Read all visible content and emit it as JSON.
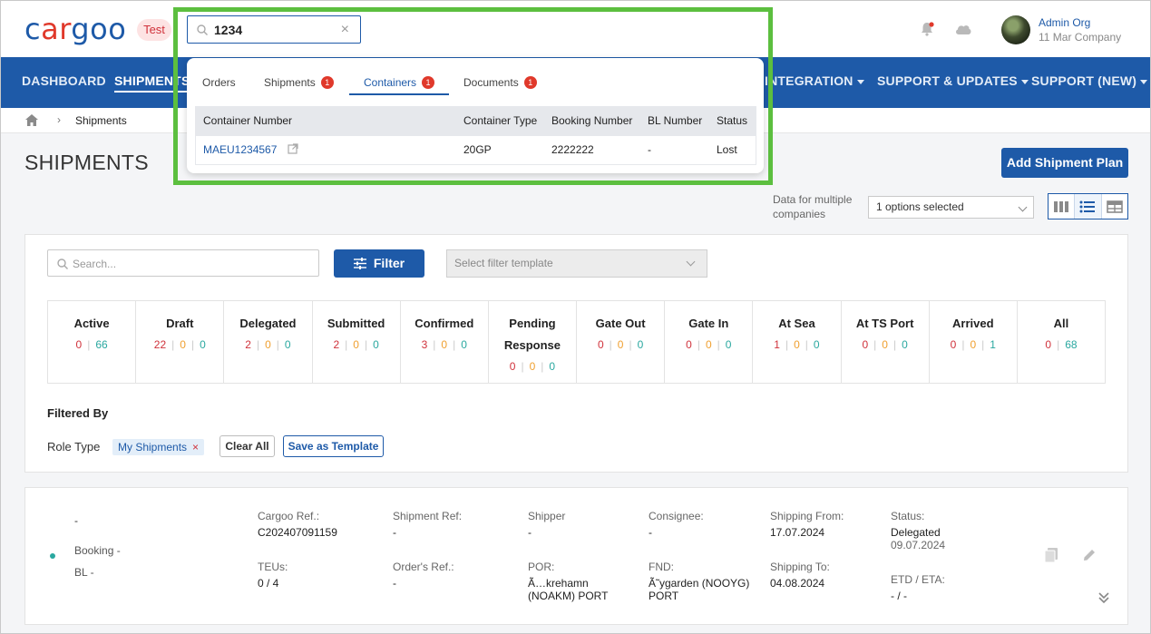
{
  "header": {
    "logo": {
      "part1": "c",
      "part2": "ar",
      "part3": "goo"
    },
    "env_badge": "Test",
    "user_name": "Admin Org",
    "user_company": "11 Mar Company"
  },
  "nav": {
    "items": [
      {
        "label": "DASHBOARD",
        "active": false,
        "caret": false
      },
      {
        "label": "SHIPMENTS",
        "active": true,
        "caret": false
      },
      {
        "label": "INTEGRATION",
        "active": false,
        "caret": true
      },
      {
        "label": "SUPPORT & UPDATES",
        "active": false,
        "caret": true
      },
      {
        "label": "SUPPORT (NEW)",
        "active": false,
        "caret": true
      }
    ]
  },
  "breadcrumb": {
    "current": "Shipments"
  },
  "page": {
    "title": "SHIPMENTS",
    "add_plan_label": "Add Shipment Plan",
    "multi_company_label": "Data for multiple companies",
    "multi_company_value": "1 options selected"
  },
  "filters": {
    "search_placeholder": "Search...",
    "filter_label": "Filter",
    "template_placeholder": "Select filter template",
    "statuses": [
      {
        "name": "Active",
        "n": [
          "0",
          "66"
        ],
        "colors": [
          "red",
          "teal"
        ]
      },
      {
        "name": "Draft",
        "n": [
          "22",
          "0",
          "0"
        ],
        "colors": [
          "red",
          "orange",
          "teal"
        ]
      },
      {
        "name": "Delegated",
        "n": [
          "2",
          "0",
          "0"
        ],
        "colors": [
          "red",
          "orange",
          "teal"
        ]
      },
      {
        "name": "Submitted",
        "n": [
          "2",
          "0",
          "0"
        ],
        "colors": [
          "red",
          "orange",
          "teal"
        ]
      },
      {
        "name": "Confirmed",
        "n": [
          "3",
          "0",
          "0"
        ],
        "colors": [
          "red",
          "orange",
          "teal"
        ]
      },
      {
        "name": "Pending Response",
        "n": [
          "0",
          "0",
          "0"
        ],
        "colors": [
          "red",
          "orange",
          "teal"
        ]
      },
      {
        "name": "Gate Out",
        "n": [
          "0",
          "0",
          "0"
        ],
        "colors": [
          "red",
          "orange",
          "teal"
        ]
      },
      {
        "name": "Gate In",
        "n": [
          "0",
          "0",
          "0"
        ],
        "colors": [
          "red",
          "orange",
          "teal"
        ]
      },
      {
        "name": "At Sea",
        "n": [
          "1",
          "0",
          "0"
        ],
        "colors": [
          "red",
          "orange",
          "teal"
        ]
      },
      {
        "name": "At TS Port",
        "n": [
          "0",
          "0",
          "0"
        ],
        "colors": [
          "red",
          "orange",
          "teal"
        ]
      },
      {
        "name": "Arrived",
        "n": [
          "0",
          "0",
          "1"
        ],
        "colors": [
          "red",
          "orange",
          "teal"
        ]
      },
      {
        "name": "All",
        "n": [
          "0",
          "68"
        ],
        "colors": [
          "red",
          "teal"
        ]
      }
    ],
    "filtered_by_label": "Filtered By",
    "role_type_label": "Role Type",
    "role_chip": "My Shipments",
    "clear_all_label": "Clear All",
    "save_template_label": "Save as Template"
  },
  "shipment": {
    "name": "-",
    "booking": "Booking -",
    "bl": "BL -",
    "cargoo_ref_label": "Cargoo Ref.:",
    "cargoo_ref": "C202407091159",
    "teus_label": "TEUs:",
    "teus": "0 / 4",
    "shipment_ref_label": "Shipment Ref:",
    "shipment_ref": "-",
    "orders_ref_label": "Order's Ref.:",
    "orders_ref": "-",
    "shipper_label": "Shipper",
    "shipper": "-",
    "por_label": "POR:",
    "por": "Ã…krehamn (NOAKM) PORT",
    "consignee_label": "Consignee:",
    "consignee": "-",
    "fnd_label": "FND:",
    "fnd": "Ã˜ygarden (NOOYG) PORT",
    "shipping_from_label": "Shipping From:",
    "shipping_from": "17.07.2024",
    "shipping_to_label": "Shipping To:",
    "shipping_to": "04.08.2024",
    "status_label": "Status:",
    "status": "Delegated",
    "status_date": "09.07.2024",
    "etd_eta_label": "ETD / ETA:",
    "etd_eta": "- / -"
  },
  "global_search": {
    "value": "1234",
    "tabs": [
      {
        "label": "Orders",
        "badge": null
      },
      {
        "label": "Shipments",
        "badge": "1"
      },
      {
        "label": "Containers",
        "badge": "1"
      },
      {
        "label": "Documents",
        "badge": "1"
      }
    ],
    "active_tab": "Containers",
    "columns": [
      "Container Number",
      "Container Type",
      "Booking Number",
      "BL Number",
      "Status"
    ],
    "rows": [
      [
        "MAEU1234567",
        "20GP",
        "2222222",
        "-",
        "Lost"
      ]
    ]
  },
  "colors": {
    "primary": "#1e5aa8",
    "highlight": "#5cbf3f",
    "red": "#d0323b",
    "orange": "#f0a030",
    "teal": "#2aa8a0"
  }
}
